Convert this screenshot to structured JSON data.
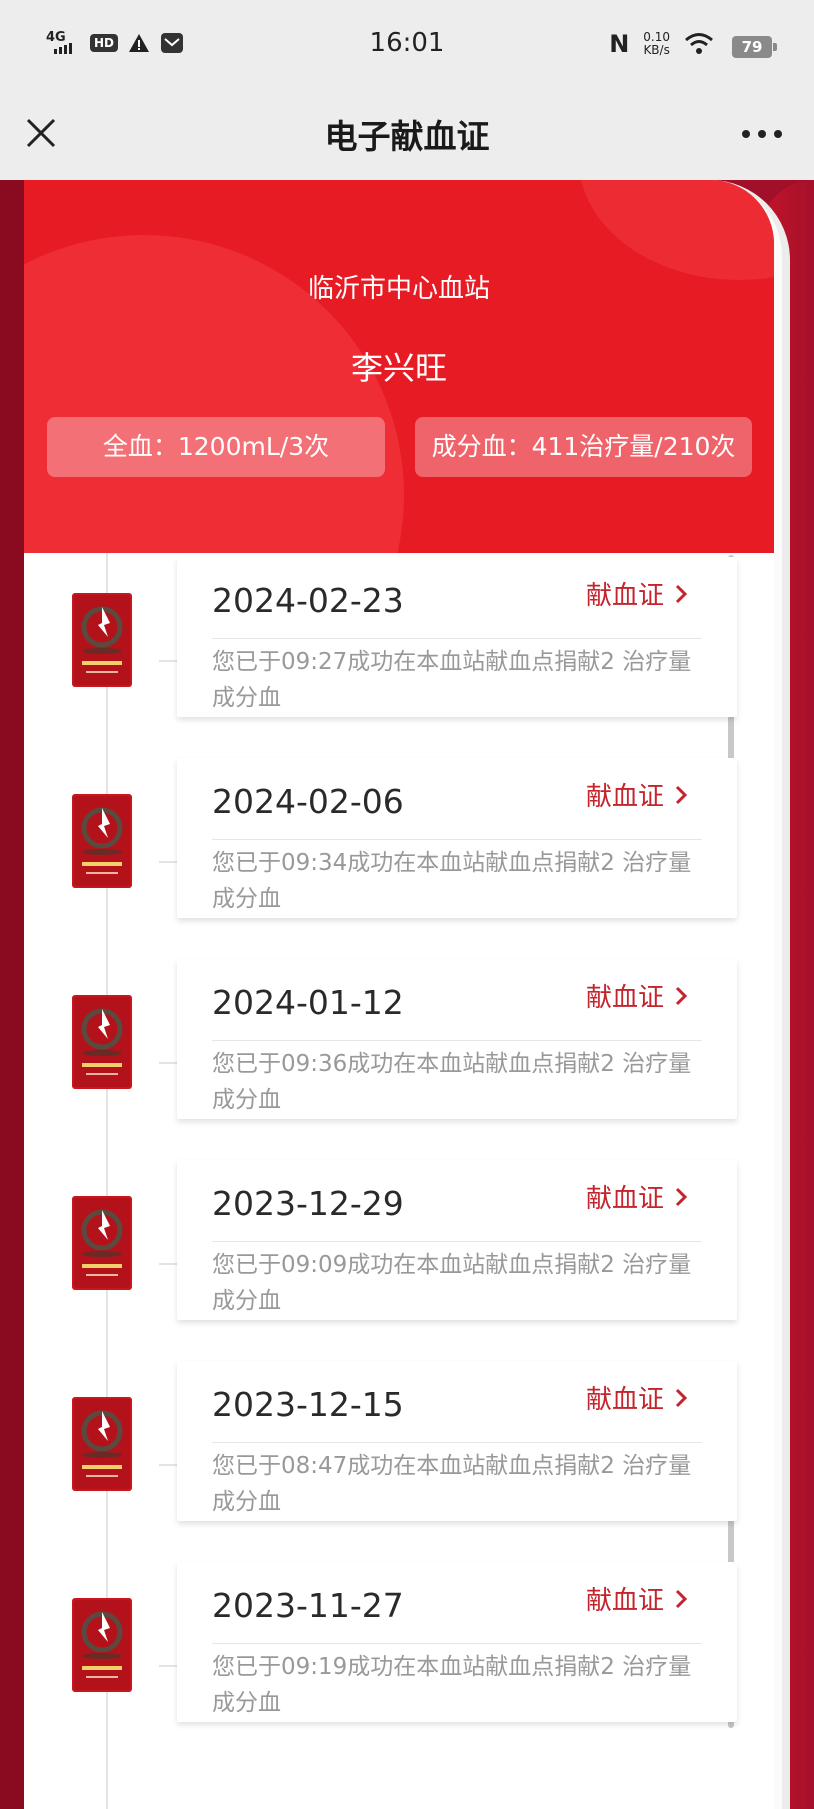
{
  "status_bar": {
    "network": "4G",
    "hd": "HD",
    "time": "16:01",
    "speed_value": "0.10",
    "speed_unit": "KB/s",
    "battery": "79"
  },
  "title_bar": {
    "title": "电子献血证"
  },
  "header": {
    "station": "临沂市中心血站",
    "donor_name": "李兴旺",
    "whole_blood": "全血：1200mL/3次",
    "component_blood": "成分血：411治疗量/210次"
  },
  "records": [
    {
      "date": "2024-02-23",
      "link_label": "献血证",
      "description": "您已于09:27成功在本血站献血点捐献2 治疗量成分血"
    },
    {
      "date": "2024-02-06",
      "link_label": "献血证",
      "description": "您已于09:34成功在本血站献血点捐献2 治疗量成分血"
    },
    {
      "date": "2024-01-12",
      "link_label": "献血证",
      "description": "您已于09:36成功在本血站献血点捐献2 治疗量成分血"
    },
    {
      "date": "2023-12-29",
      "link_label": "献血证",
      "description": "您已于09:09成功在本血站献血点捐献2 治疗量成分血"
    },
    {
      "date": "2023-12-15",
      "link_label": "献血证",
      "description": "您已于08:47成功在本血站献血点捐献2 治疗量成分血"
    },
    {
      "date": "2023-11-27",
      "link_label": "献血证",
      "description": "您已于09:19成功在本血站献血点捐献2 治疗量成分血"
    }
  ],
  "colors": {
    "header_red": "#e71b24",
    "accent_red": "#c4242c",
    "side_dark_red": "#8e0b22"
  },
  "icons": {
    "close": "close-icon",
    "more": "more-icon",
    "badge": "blood-certificate-badge-icon",
    "chevron": "chevron-right-icon"
  }
}
